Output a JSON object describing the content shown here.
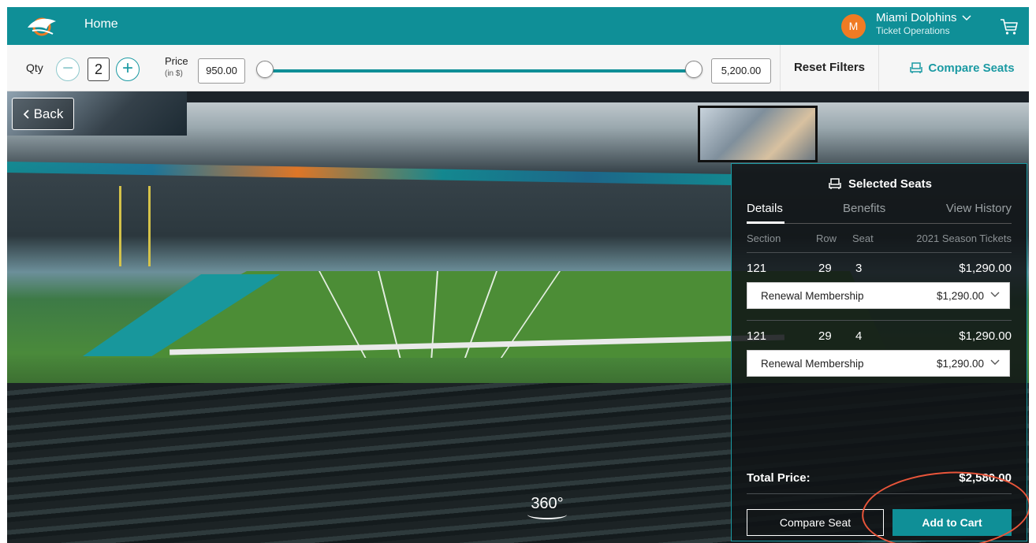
{
  "header": {
    "home_label": "Home",
    "avatar_initial": "M",
    "account_name": "Miami Dolphins",
    "account_role": "Ticket Operations"
  },
  "filters": {
    "qty_label": "Qty",
    "qty_value": "2",
    "price_label": "Price",
    "price_unit": "(in $)",
    "price_min": "950.00",
    "price_max": "5,200.00",
    "reset_label": "Reset Filters",
    "compare_label": "Compare Seats"
  },
  "view": {
    "back_label": "Back",
    "view360_label": "360°"
  },
  "panel": {
    "title": "Selected Seats",
    "tabs": [
      "Details",
      "Benefits",
      "View History"
    ],
    "columns": {
      "section": "Section",
      "row": "Row",
      "seat": "Seat",
      "price": "2021 Season Tickets"
    },
    "seats": [
      {
        "section": "121",
        "row": "29",
        "seat": "3",
        "price": "$1,290.00",
        "option": "Renewal Membership",
        "option_price": "$1,290.00"
      },
      {
        "section": "121",
        "row": "29",
        "seat": "4",
        "price": "$1,290.00",
        "option": "Renewal Membership",
        "option_price": "$1,290.00"
      }
    ],
    "total_label": "Total Price:",
    "total_value": "$2,580.00",
    "compare_button": "Compare Seat",
    "cart_button": "Add to Cart"
  },
  "colors": {
    "brand_teal": "#0f8f97",
    "avatar_orange": "#f07b23",
    "annotation_red": "#e8553a"
  },
  "icons": [
    "dolphins-logo-icon",
    "chevron-down-icon",
    "cart-icon",
    "minus-icon",
    "plus-icon",
    "seat-icon",
    "chevron-left-icon",
    "rotate-360-icon"
  ]
}
